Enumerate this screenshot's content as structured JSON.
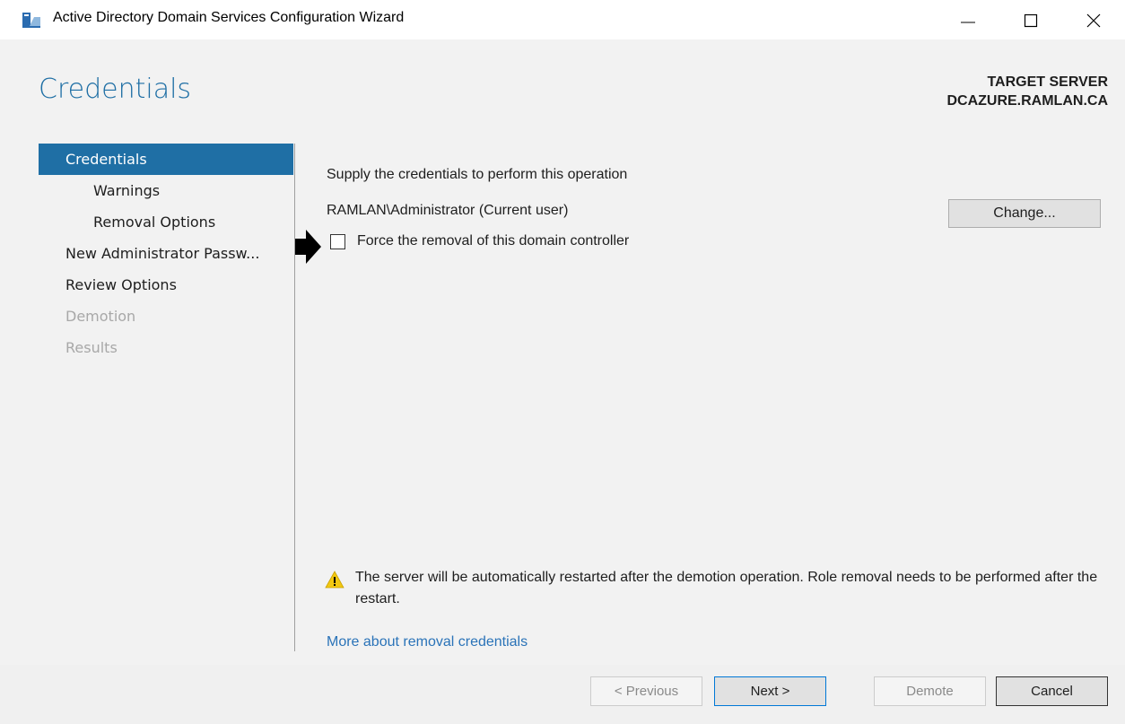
{
  "window": {
    "title": "Active Directory Domain Services Configuration Wizard",
    "icon": "server-icon"
  },
  "page": {
    "title": "Credentials",
    "target_label": "TARGET SERVER",
    "target_server": "DCAZURE.RAMLAN.CA"
  },
  "nav": {
    "items": [
      {
        "label": "Credentials",
        "state": "active"
      },
      {
        "label": "Warnings",
        "state": "sub"
      },
      {
        "label": "Removal Options",
        "state": "sub"
      },
      {
        "label": "New Administrator Passw...",
        "state": "normal"
      },
      {
        "label": "Review Options",
        "state": "normal"
      },
      {
        "label": "Demotion",
        "state": "disabled"
      },
      {
        "label": "Results",
        "state": "disabled"
      }
    ]
  },
  "main": {
    "supply_text": "Supply the credentials to perform this operation",
    "current_user": "RAMLAN\\Administrator (Current user)",
    "change_button": "Change...",
    "force_removal_label": "Force the removal of this domain controller",
    "force_removal_checked": false,
    "warning_text": "The server will be automatically restarted after the demotion operation. Role removal needs to be performed after the restart.",
    "more_link": "More about removal credentials"
  },
  "footer": {
    "previous": "< Previous",
    "next": "Next >",
    "demote": "Demote",
    "cancel": "Cancel"
  },
  "colors": {
    "accent": "#1f6fa5",
    "link": "#2a73b8",
    "warning": "#f2c811"
  }
}
